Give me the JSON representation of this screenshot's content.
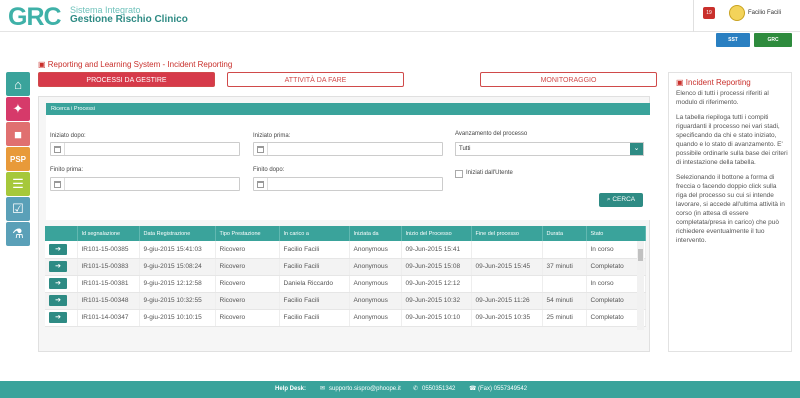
{
  "header": {
    "logo": "GRC",
    "logo_line1": "Sistema Integrato",
    "logo_line2": "Gestione Rischio Clinico",
    "notification_count": "19",
    "username": "Facilio Facili",
    "partners": [
      "SST",
      "GRC"
    ]
  },
  "page": {
    "title": "Reporting and Learning System - Incident Reporting"
  },
  "tabs": [
    {
      "label": "PROCESSI DA GESTIRE",
      "active": true
    },
    {
      "label": "ATTIVITÀ DA FARE",
      "active": false
    },
    {
      "label": "MONITORAGGIO",
      "active": false
    }
  ],
  "search": {
    "panel_title": "Ricerca i Processi",
    "started_after_label": "Iniziato dopo:",
    "started_before_label": "Iniziato prima:",
    "ended_before_label": "Finito prima:",
    "ended_after_label": "Finito dopo:",
    "progress_label": "Avanzamento del processo",
    "progress_value": "Tutti",
    "user_started_label": "Iniziati dall'Utente",
    "search_button": "CERCA"
  },
  "table": {
    "columns": [
      "",
      "Id segnalazione",
      "Data Registrazione",
      "Tipo Prestazione",
      "In carico a",
      "Iniziata da",
      "Inizio del Processo",
      "Fine del processo",
      "Durata",
      "Stato"
    ],
    "rows": [
      [
        "IR101-15-00385",
        "9-giu-2015 15:41:03",
        "Ricovero",
        "Facilio Facili",
        "Anonymous",
        "09-Jun-2015 15:41",
        "",
        "",
        "In corso"
      ],
      [
        "IR101-15-00383",
        "9-giu-2015 15:08:24",
        "Ricovero",
        "Facilio Facili",
        "Anonymous",
        "09-Jun-2015 15:08",
        "09-Jun-2015 15:45",
        "37 minuti",
        "Completato"
      ],
      [
        "IR101-15-00381",
        "9-giu-2015 12:12:58",
        "Ricovero",
        "Daniela Riccardo",
        "Anonymous",
        "09-Jun-2015 12:12",
        "",
        "",
        "In corso"
      ],
      [
        "IR101-15-00348",
        "9-giu-2015 10:32:55",
        "Ricovero",
        "Facilio Facili",
        "Anonymous",
        "09-Jun-2015 10:32",
        "09-Jun-2015 11:26",
        "54 minuti",
        "Completato"
      ],
      [
        "IR101-14-00347",
        "9-giu-2015 10:10:15",
        "Ricovero",
        "Facilio Facili",
        "Anonymous",
        "09-Jun-2015 10:10",
        "09-Jun-2015 10:35",
        "25 minuti",
        "Completato"
      ]
    ]
  },
  "help": {
    "title": "Incident Reporting",
    "p1": "Elenco di tutti i processi riferiti al modulo di riferimento.",
    "p2": "La tabella riepiloga tutti i compiti riguardanti il processo nei vari stadi, specificando da chi e stato iniziato, quando e lo stato di avanzamento. E' possibile ordinarle sulla base dei criteri di intestazione della tabella.",
    "p3": "Selezionando il bottone a forma di freccia o facendo doppio click sulla riga del processo su cui si intende lavorare, si accede all'ultima attività in corso (in attesa di essere completata/presa in carico) che può richiedere eventualmente il tuo intervento."
  },
  "footer": {
    "helpdesk_label": "Help Desk:",
    "email": "supporto.sispro@phoope.it",
    "phone": "0550351342",
    "fax": "(Fax) 0557349542"
  },
  "colors": {
    "accent": "#3aa39b",
    "accent_dark": "#2e8b84",
    "primary_red": "#d63a4a"
  }
}
